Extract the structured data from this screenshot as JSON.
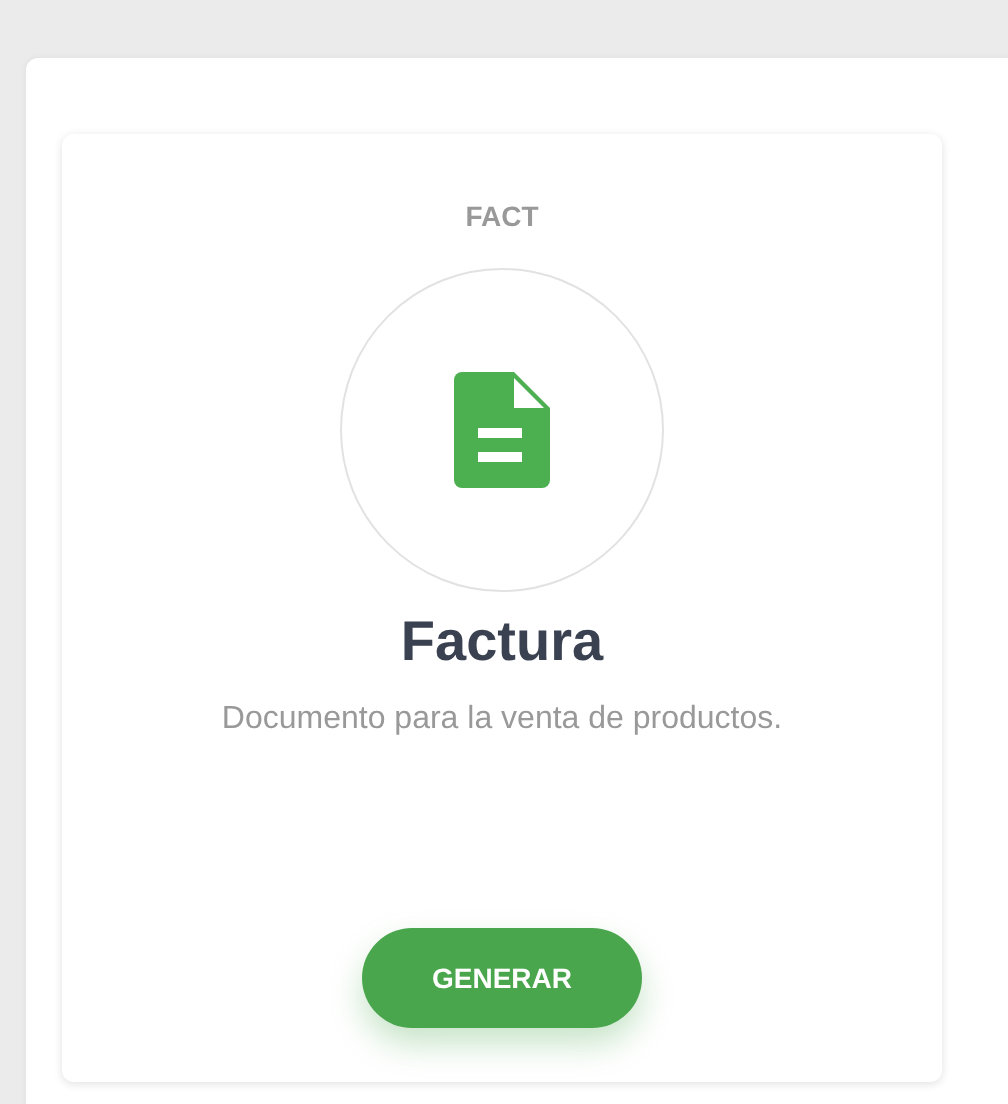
{
  "card": {
    "code": "FACT",
    "title": "Factura",
    "description": "Documento para la venta de productos.",
    "button": "GENERAR"
  }
}
